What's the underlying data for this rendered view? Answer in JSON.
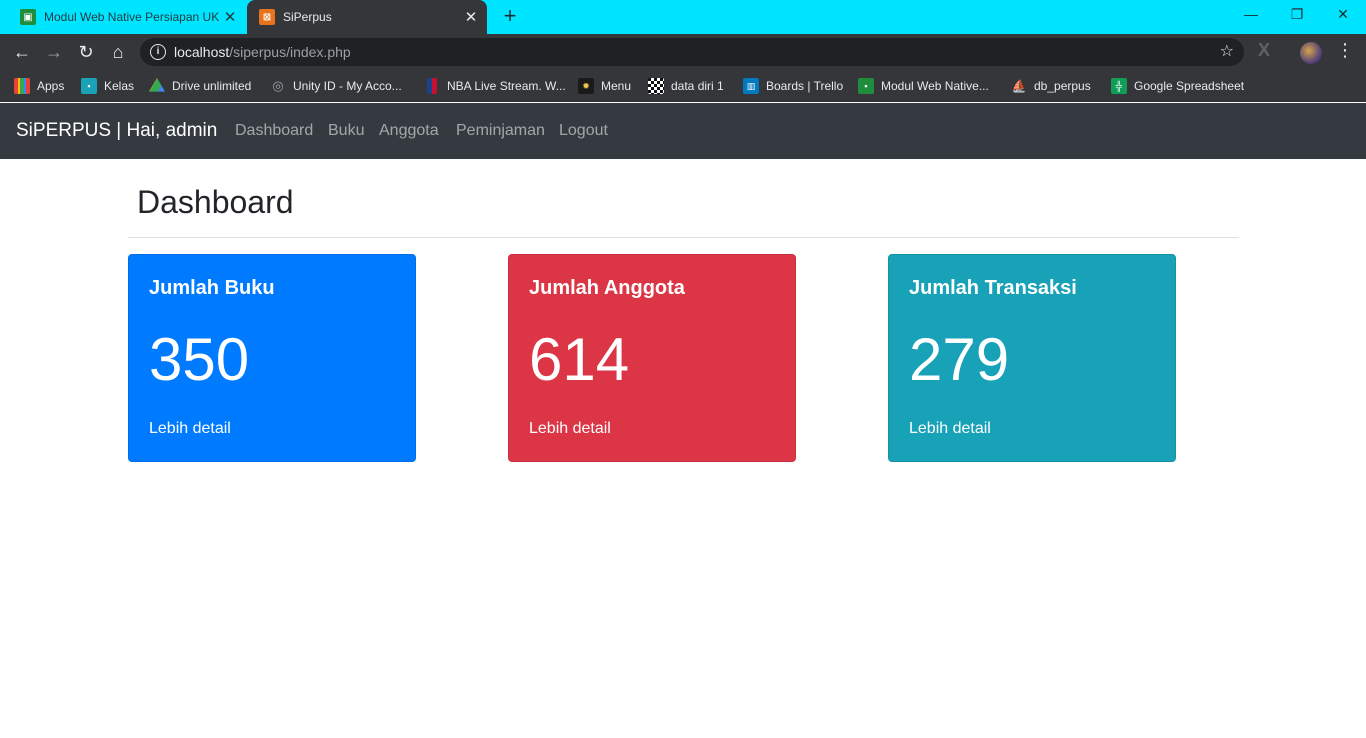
{
  "browser": {
    "tabs": [
      {
        "title": "Modul Web Native Persiapan UKK",
        "favicon_color": "#1e8e3e"
      },
      {
        "title": "SiPerpus",
        "favicon_color": "#e8731c"
      }
    ],
    "url_host": "localhost",
    "url_path": "/siperpus/index.php",
    "bookmarks": [
      {
        "label": "Apps",
        "icon": "apps-grid-icon"
      },
      {
        "label": "Kelas",
        "icon": "classroom-icon"
      },
      {
        "label": "Drive unlimited",
        "icon": "google-drive-icon"
      },
      {
        "label": "Unity ID - My Acco...",
        "icon": "unity-icon"
      },
      {
        "label": "NBA Live Stream. W...",
        "icon": "nba-icon"
      },
      {
        "label": "Menu",
        "icon": "menu-icon"
      },
      {
        "label": "data diri 1",
        "icon": "qr-icon"
      },
      {
        "label": "Boards | Trello",
        "icon": "trello-icon"
      },
      {
        "label": "Modul Web Native...",
        "icon": "classroom-icon"
      },
      {
        "label": "db_perpus",
        "icon": "phpmyadmin-icon"
      },
      {
        "label": "Google Spreadsheet",
        "icon": "sheets-icon"
      }
    ]
  },
  "navbar": {
    "brand": "SiPERPUS | Hai, admin",
    "links": [
      "Dashboard",
      "Buku",
      "Anggota",
      "Peminjaman",
      "Logout"
    ]
  },
  "page": {
    "title": "Dashboard",
    "cards": [
      {
        "title": "Jumlah Buku",
        "value": "350",
        "link": "Lebih detail",
        "color": "#007bff"
      },
      {
        "title": "Jumlah Anggota",
        "value": "614",
        "link": "Lebih detail",
        "color": "#dc3545"
      },
      {
        "title": "Jumlah Transaksi",
        "value": "279",
        "link": "Lebih detail",
        "color": "#17a2b8"
      }
    ]
  }
}
